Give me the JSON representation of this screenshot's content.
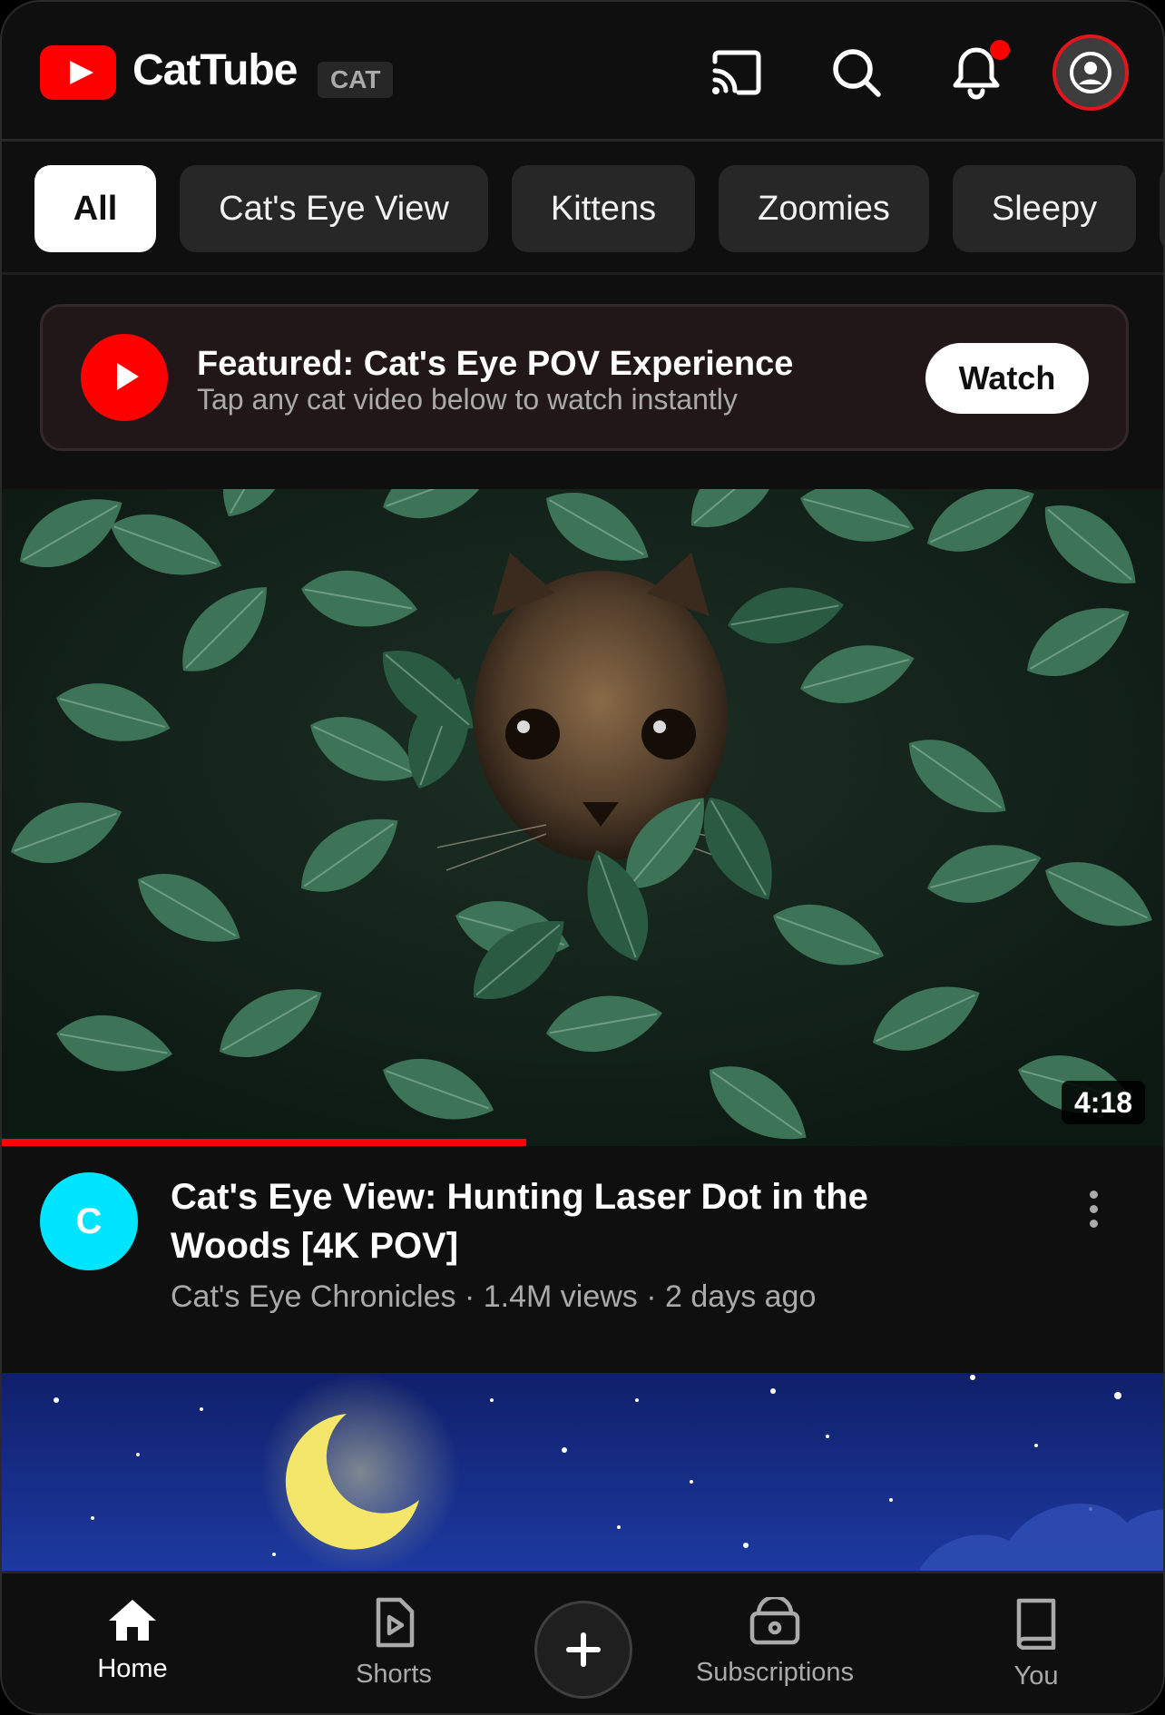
{
  "header": {
    "brand": "CatTube",
    "badge": "CAT",
    "icons": [
      "cast-icon",
      "search-icon",
      "bell-icon",
      "account-icon"
    ]
  },
  "chips": [
    "All",
    "Cat's Eye View",
    "Kittens",
    "Zoomies",
    "Sleepy"
  ],
  "active_chip": "All",
  "featured": {
    "title": "Featured: Cat's Eye POV Experience",
    "subtitle": "Tap any cat video below to watch instantly",
    "button": "Watch"
  },
  "video1": {
    "duration": "4:18",
    "progress_fraction": 0.45,
    "channel_initial": "C",
    "title": "Cat's Eye View: Hunting Laser Dot in the Woods [4K POV]",
    "channel": "Cat's Eye Chronicles",
    "views": "1.4M views",
    "age": "2 days ago",
    "separator": "·"
  },
  "nav": {
    "home": "Home",
    "shorts": "Shorts",
    "subscriptions": "Subscriptions",
    "you": "You"
  },
  "colors": {
    "brand_red": "#ff0000",
    "background": "#0f0f0f",
    "chip_bg": "#272727",
    "channel_avatar": "#00e5ff"
  }
}
